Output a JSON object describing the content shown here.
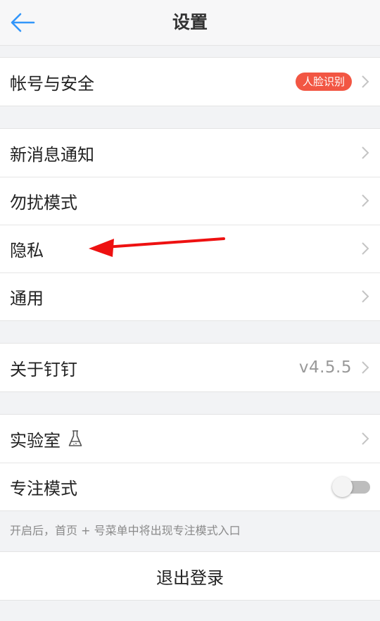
{
  "header": {
    "title": "设置",
    "back_icon": "back-arrow-icon",
    "accent_color": "#3296fa"
  },
  "account": {
    "label": "帐号与安全",
    "badge": "人脸识别",
    "badge_color": "#f25643"
  },
  "notifications_group": {
    "items": [
      {
        "label": "新消息通知"
      },
      {
        "label": "勿扰模式"
      },
      {
        "label": "隐私"
      },
      {
        "label": "通用"
      }
    ]
  },
  "about": {
    "label": "关于钉钉",
    "version": "v4.5.5"
  },
  "lab_group": {
    "lab_label": "实验室",
    "lab_icon": "flask-icon",
    "focus_label": "专注模式",
    "focus_enabled": false,
    "focus_hint": "开启后，首页 + 号菜单中将出现专注模式入口"
  },
  "logout": {
    "label": "退出登录"
  },
  "annotation": {
    "icon": "red-arrow-icon",
    "color": "#ee1111"
  }
}
